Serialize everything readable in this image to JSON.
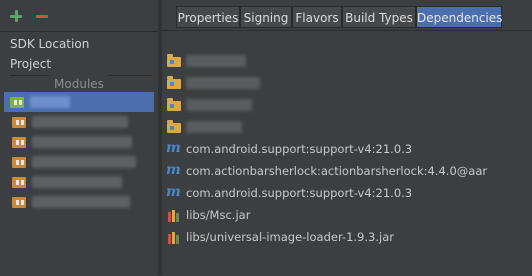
{
  "toolbar": {
    "add_icon": "plus-icon",
    "remove_icon": "minus-icon"
  },
  "nav": {
    "sdk_location": "SDK Location",
    "project": "Project",
    "modules_header": "Modules"
  },
  "modules": {
    "count_visible": 6,
    "selected_index": 0
  },
  "tabs": [
    {
      "label": "Properties"
    },
    {
      "label": "Signing"
    },
    {
      "label": "Flavors"
    },
    {
      "label": "Build Types"
    },
    {
      "label": "Dependencies"
    }
  ],
  "active_tab": "Dependencies",
  "dependencies": [
    {
      "type": "module",
      "label": ""
    },
    {
      "type": "module",
      "label": ""
    },
    {
      "type": "module",
      "label": ""
    },
    {
      "type": "module",
      "label": ""
    },
    {
      "type": "maven",
      "label": "com.android.support:support-v4:21.0.3"
    },
    {
      "type": "maven",
      "label": "com.actionbarsherlock:actionbarsherlock:4.4.0@aar"
    },
    {
      "type": "maven",
      "label": "com.android.support:support-v4:21.0.3"
    },
    {
      "type": "jar",
      "label": "libs/Msc.jar"
    },
    {
      "type": "jar",
      "label": "libs/universal-image-loader-1.9.3.jar"
    }
  ],
  "colors": {
    "accent": "#4b6eaf",
    "add": "#59a869",
    "remove": "#d94f4f",
    "maven": "#4a88c7",
    "folder": "#d9a94a"
  }
}
